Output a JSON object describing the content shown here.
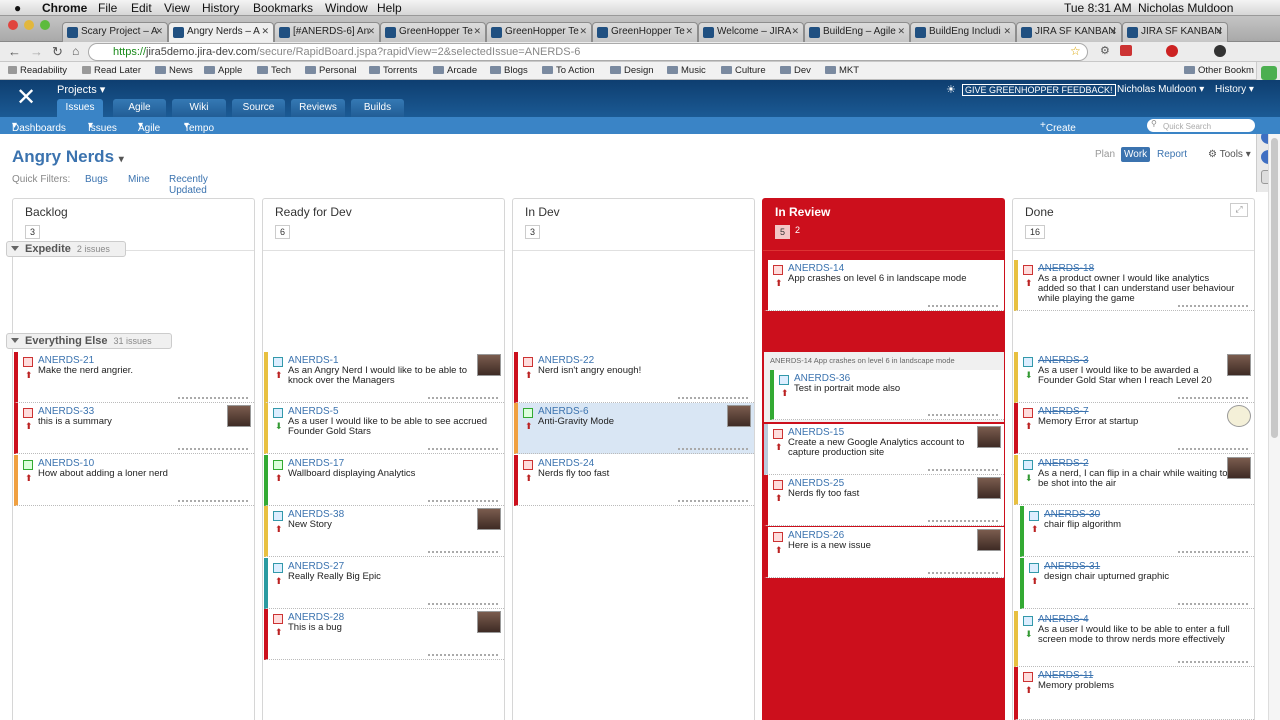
{
  "menubar": {
    "apple": "",
    "app": "Chrome",
    "items": [
      "File",
      "Edit",
      "View",
      "History",
      "Bookmarks",
      "Window",
      "Help"
    ],
    "clock": "Tue 8:31 AM",
    "user": "Nicholas Muldoon"
  },
  "tabs": [
    "Scary Project – A",
    "Angry Nerds – A",
    "[#ANERDS-6] An",
    "GreenHopper Te",
    "GreenHopper Te",
    "GreenHopper Te",
    "Welcome – JIRA",
    "BuildEng – Agile",
    "BuildEng Includi",
    "JIRA SF KANBAN",
    "JIRA SF KANBAN"
  ],
  "url": {
    "scheme": "https://",
    "host": "jira5demo.jira-dev.com",
    "path": "/secure/RapidBoard.jspa?rapidView=2&selectedIssue=ANERDS-6"
  },
  "bookmarks": [
    "Readability",
    "Read Later",
    "News",
    "Apple",
    "Tech",
    "Personal",
    "Torrents",
    "Arcade",
    "Blogs",
    "To Action",
    "Design",
    "Music",
    "Culture",
    "Dev",
    "MKT"
  ],
  "other_bookmarks": "Other Bookm",
  "header": {
    "projects": "Projects",
    "tabs": [
      "Issues",
      "Agile",
      "Wiki",
      "Source",
      "Reviews",
      "Builds"
    ],
    "feedback": "GIVE GREENHOPPER FEEDBACK!",
    "user": "Nicholas Muldoon",
    "history": "History"
  },
  "subnav": {
    "items": [
      "Dashboards",
      "Issues",
      "Agile",
      "Tempo"
    ],
    "create": "Create new issue",
    "search_placeholder": "Quick Search"
  },
  "board": {
    "title": "Angry Nerds",
    "quick_filters_label": "Quick Filters:",
    "quick_filters": [
      "Bugs",
      "Mine",
      "Recently Updated"
    ],
    "modes": [
      "Plan",
      "Work",
      "Report"
    ],
    "tools": "Tools"
  },
  "columns": [
    {
      "name": "Backlog",
      "count": "3"
    },
    {
      "name": "Ready for Dev",
      "count": "6"
    },
    {
      "name": "In Dev",
      "count": "3"
    },
    {
      "name": "In Review",
      "count": "5",
      "limit": "2"
    },
    {
      "name": "Done",
      "count": "16"
    }
  ],
  "swimlanes": [
    {
      "name": "Expedite",
      "count": "2 issues"
    },
    {
      "name": "Everything Else",
      "count": "31 issues"
    }
  ],
  "parent_note": "ANERDS-14   App crashes on level 6 in landscape mode",
  "cards": {
    "c1": {
      "key": "ANERDS-14",
      "sum": "App crashes on level 6 in landscape mode"
    },
    "c2": {
      "key": "ANERDS-18",
      "sum": "As a product owner I would like analytics added so that I can understand user behaviour while playing the game"
    },
    "c3": {
      "key": "ANERDS-21",
      "sum": "Make the nerd angrier."
    },
    "c4": {
      "key": "ANERDS-33",
      "sum": "this is a summary"
    },
    "c5": {
      "key": "ANERDS-10",
      "sum": "How about adding a loner nerd"
    },
    "c6": {
      "key": "ANERDS-1",
      "sum": "As an Angry Nerd I would like to be able to knock over the Managers"
    },
    "c7": {
      "key": "ANERDS-5",
      "sum": "As a user I would like to be able to see accrued Founder Gold Stars"
    },
    "c8": {
      "key": "ANERDS-17",
      "sum": "Wallboard displaying Analytics"
    },
    "c9": {
      "key": "ANERDS-38",
      "sum": "New Story"
    },
    "c10": {
      "key": "ANERDS-27",
      "sum": "Really Really Big Epic"
    },
    "c11": {
      "key": "ANERDS-28",
      "sum": "This is a bug"
    },
    "c12": {
      "key": "ANERDS-22",
      "sum": "Nerd isn't angry enough!"
    },
    "c13": {
      "key": "ANERDS-6",
      "sum": "Anti-Gravity Mode"
    },
    "c14": {
      "key": "ANERDS-24",
      "sum": "Nerds fly too fast"
    },
    "c15": {
      "key": "ANERDS-36",
      "sum": "Test in portrait mode also"
    },
    "c16": {
      "key": "ANERDS-15",
      "sum": "Create a new Google Analytics account to capture production site"
    },
    "c17": {
      "key": "ANERDS-25",
      "sum": "Nerds fly too fast"
    },
    "c18": {
      "key": "ANERDS-26",
      "sum": "Here is a new issue"
    },
    "c19": {
      "key": "ANERDS-3",
      "sum": "As a user I would like to be awarded a Founder Gold Star when I reach Level 20"
    },
    "c20": {
      "key": "ANERDS-7",
      "sum": "Memory Error at startup"
    },
    "c21": {
      "key": "ANERDS-2",
      "sum": "As a nerd, I can flip in a chair while waiting to be shot into the air"
    },
    "c22": {
      "key": "ANERDS-30",
      "sum": "chair flip algorithm"
    },
    "c23": {
      "key": "ANERDS-31",
      "sum": "design chair upturned graphic"
    },
    "c24": {
      "key": "ANERDS-4",
      "sum": "As a user I would like to be able to enter a full screen mode to throw nerds more effectively"
    },
    "c25": {
      "key": "ANERDS-11",
      "sum": "Memory problems"
    }
  },
  "colors": {
    "header": "#1b5a94",
    "accent": "#3b73af",
    "review": "#cc0f1c"
  }
}
